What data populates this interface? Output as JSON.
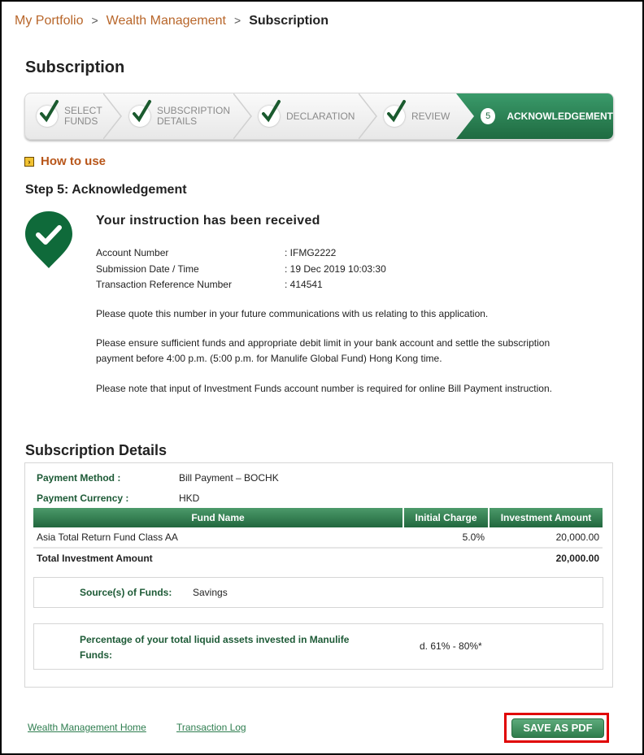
{
  "breadcrumb": {
    "items": [
      "My Portfolio",
      "Wealth Management"
    ],
    "separator": ">",
    "current": "Subscription"
  },
  "page_title": "Subscription",
  "stepper": {
    "steps": [
      {
        "label_line1": "SELECT",
        "label_line2": "FUNDS",
        "status": "completed"
      },
      {
        "label_line1": "SUBSCRIPTION",
        "label_line2": "DETAILS",
        "status": "completed"
      },
      {
        "label_line1": "DECLARATION",
        "label_line2": "",
        "status": "completed"
      },
      {
        "label_line1": "REVIEW",
        "label_line2": "",
        "status": "completed"
      },
      {
        "label_line1": "ACKNOWLEDGEMENT",
        "label_line2": "",
        "status": "active",
        "number": "5"
      }
    ],
    "accent_color": "#1f6b41"
  },
  "how_to_use": {
    "icon": "arrow-box-icon",
    "label": "How to use"
  },
  "step_heading": "Step 5: Acknowledgement",
  "confirmation": {
    "icon": "check-pin-icon",
    "title": "Your instruction has been received",
    "fields": [
      {
        "label": "Account Number",
        "value": ": IFMG2222"
      },
      {
        "label": "Submission Date / Time",
        "value": ": 19 Dec 2019 10:03:30"
      },
      {
        "label": "Transaction Reference Number",
        "value": ": 414541"
      }
    ],
    "notes": [
      "Please quote this number in your future communications with us relating to this application.",
      "Please ensure sufficient funds and appropriate debit limit in your bank account and settle the subscription payment before 4:00 p.m. (5:00 p.m. for Manulife Global Fund) Hong Kong time.",
      "Please note that input of Investment Funds account number is required for online Bill Payment instruction."
    ]
  },
  "subscription_details": {
    "title": "Subscription Details",
    "payment_method_label": "Payment Method :",
    "payment_method": "Bill Payment – BOCHK",
    "payment_currency_label": "Payment Currency :",
    "payment_currency": "HKD",
    "columns": [
      "Fund Name",
      "Initial Charge",
      "Investment Amount"
    ],
    "rows": [
      {
        "fund_name": "Asia Total Return Fund Class AA",
        "initial_charge": "5.0%",
        "investment_amount": "20,000.00"
      }
    ],
    "total_label": "Total Investment Amount",
    "total_amount": "20,000.00",
    "source_of_funds_label": "Source(s) of Funds:",
    "source_of_funds": "Savings",
    "liquid_assets_label_line1": "Percentage of your total liquid assets invested in Manulife",
    "liquid_assets_label_line2": "Funds:",
    "liquid_assets_value": "d. 61% - 80%*"
  },
  "footer": {
    "links": [
      "Wealth Management Home",
      "Transaction Log"
    ],
    "save_pdf_label": "SAVE AS PDF"
  }
}
